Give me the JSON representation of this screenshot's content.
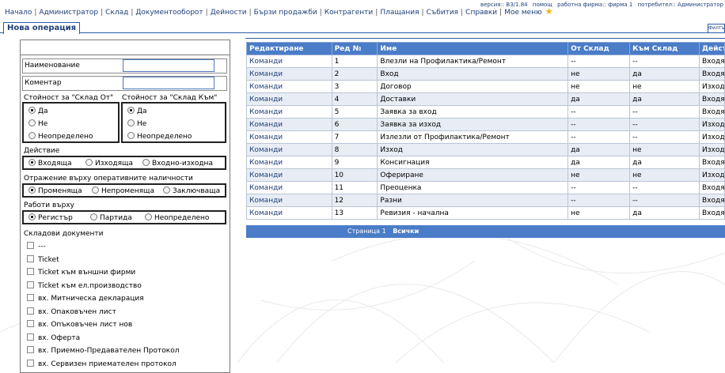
{
  "nav": {
    "items": [
      "Начало",
      "Администратор",
      "Склад",
      "Документооборот",
      "Дейности",
      "Бързи продажби",
      "Контрагенти",
      "Плащания",
      "Събития",
      "Справки",
      "Мое меню"
    ],
    "star": "★"
  },
  "info": {
    "version": "версия:: B3/1.84",
    "help": "помощ",
    "company": "работна фирма:: фирма 1",
    "user": "потребител:: Администратор"
  },
  "tab": {
    "label": "Нова операция",
    "filter": "Филтър"
  },
  "form": {
    "name_label": "Наименование",
    "name_value": "",
    "comment_label": "Коментар",
    "comment_value": "",
    "from_label": "Стойност за \"Склад От\"",
    "to_label": "Стойност за \"Склад Към\"",
    "yn_options": [
      "Да",
      "Не",
      "Неопределено"
    ],
    "from_selected": "Да",
    "to_selected": "Да",
    "action_label": "Действие",
    "action_options": [
      "Входяща",
      "Изходяща",
      "Входно-изходна"
    ],
    "action_selected": "Входяща",
    "reflect_label": "Отражение върху оперативните наличности",
    "reflect_options": [
      "Променяща",
      "Непроменяща",
      "Заключваща"
    ],
    "reflect_selected": "Променяща",
    "works_label": "Работи върху",
    "works_options": [
      "Регистър",
      "Партида",
      "Неопределено"
    ],
    "works_selected": "Регистър",
    "docs_label": "Складови документи",
    "docs": [
      "---",
      "Ticket",
      "Ticket към външни фирми",
      "Ticket към ел.производство",
      "вх. Митническа декларация",
      "вх. Опаковъчен лист",
      "вх. Опъковъчен лист нов",
      "вх. Оферта",
      "вх. Приемно-Предавателен Протокол",
      "вх. Сервизен приемателен протокол"
    ]
  },
  "table": {
    "columns": [
      "Редактиране",
      "Ред №",
      "Име",
      "От Склад",
      "Към Склад",
      "Действие"
    ],
    "rows": [
      [
        "Команди",
        "1",
        "Влезли на Профилактика/Ремонт",
        "--",
        "--",
        "Входяща"
      ],
      [
        "Команди",
        "2",
        "Вход",
        "не",
        "да",
        "Входяща"
      ],
      [
        "Команди",
        "3",
        "Договор",
        "не",
        "не",
        "Изходяща"
      ],
      [
        "Команди",
        "4",
        "Доставки",
        "да",
        "да",
        "Входяща"
      ],
      [
        "Команди",
        "5",
        "Заявка за вход",
        "--",
        "--",
        "Входяща"
      ],
      [
        "Команди",
        "6",
        "Заявка за изход",
        "--",
        "--",
        "Изходяща"
      ],
      [
        "Команди",
        "7",
        "Излезли от Профилактика/Ремонт",
        "--",
        "--",
        "Изходяща"
      ],
      [
        "Команди",
        "8",
        "Изход",
        "да",
        "не",
        "Изходяща"
      ],
      [
        "Команди",
        "9",
        "Консигнация",
        "да",
        "да",
        "Входяща"
      ],
      [
        "Команди",
        "10",
        "Офериране",
        "не",
        "не",
        "Изходяща"
      ],
      [
        "Команди",
        "11",
        "Преоценка",
        "--",
        "--",
        "Входяща"
      ],
      [
        "Команди",
        "12",
        "Разни",
        "--",
        "--",
        "Входяща"
      ],
      [
        "Команди",
        "13",
        "Ревизия - начална",
        "не",
        "да",
        "Входяща"
      ]
    ]
  },
  "pager": {
    "page_label": "Страница",
    "page": "1",
    "all": "Всички"
  },
  "colors": {
    "accent": "#4a7cc7",
    "nav": "#1f3f77",
    "row_alt": "#e8edf5"
  }
}
